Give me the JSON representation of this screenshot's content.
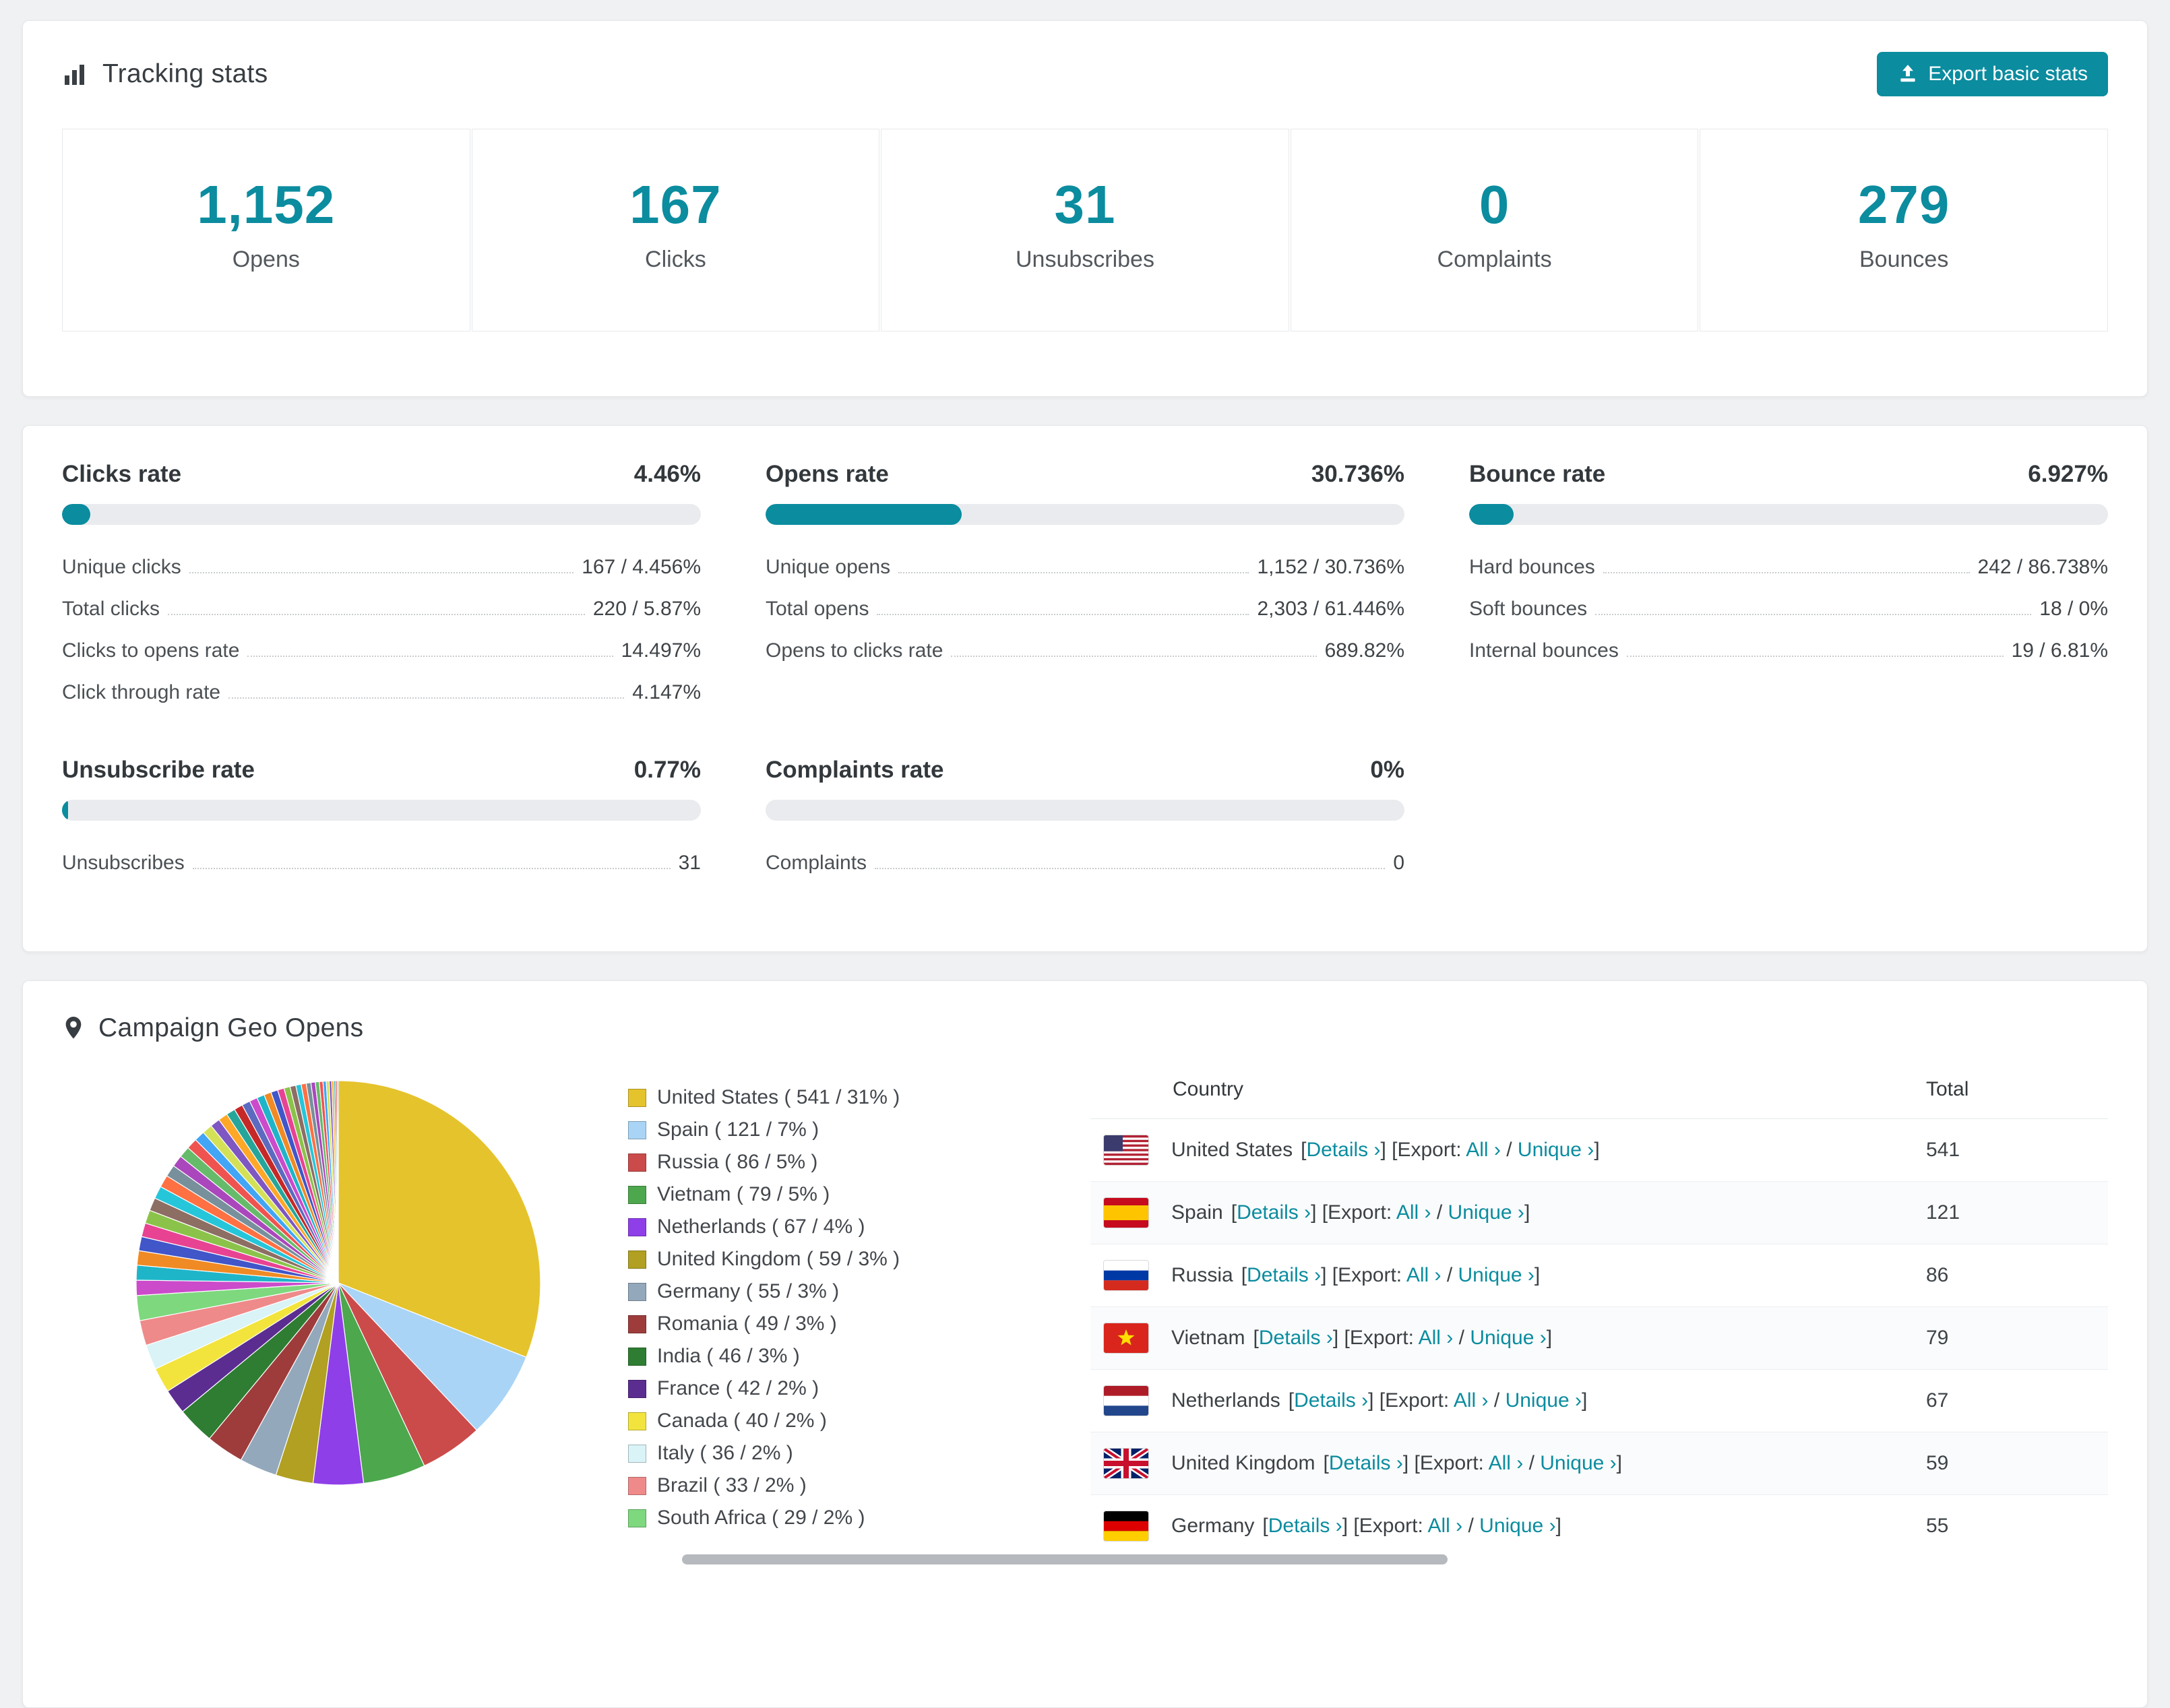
{
  "theme": {
    "accent": "#0b8c9f",
    "page_bg": "#f0f1f3",
    "card_border": "#e4e6e9",
    "bar_track": "#e9ebee"
  },
  "tracking": {
    "title": "Tracking stats",
    "export_button": "Export basic stats",
    "stats": [
      {
        "value": "1,152",
        "label": "Opens"
      },
      {
        "value": "167",
        "label": "Clicks"
      },
      {
        "value": "31",
        "label": "Unsubscribes"
      },
      {
        "value": "0",
        "label": "Complaints"
      },
      {
        "value": "279",
        "label": "Bounces"
      }
    ]
  },
  "rates": [
    {
      "title": "Clicks rate",
      "value": "4.46%",
      "percent": 4.46,
      "rows": [
        {
          "label": "Unique clicks",
          "value": "167 / 4.456%"
        },
        {
          "label": "Total clicks",
          "value": "220 / 5.87%"
        },
        {
          "label": "Clicks to opens rate",
          "value": "14.497%"
        },
        {
          "label": "Click through rate",
          "value": "4.147%"
        }
      ]
    },
    {
      "title": "Opens rate",
      "value": "30.736%",
      "percent": 30.736,
      "rows": [
        {
          "label": "Unique opens",
          "value": "1,152 / 30.736%"
        },
        {
          "label": "Total opens",
          "value": "2,303 / 61.446%"
        },
        {
          "label": "Opens to clicks rate",
          "value": "689.82%"
        }
      ]
    },
    {
      "title": "Bounce rate",
      "value": "6.927%",
      "percent": 6.927,
      "rows": [
        {
          "label": "Hard bounces",
          "value": "242 / 86.738%"
        },
        {
          "label": "Soft bounces",
          "value": "18 / 0%"
        },
        {
          "label": "Internal bounces",
          "value": "19 / 6.81%"
        }
      ]
    },
    {
      "title": "Unsubscribe rate",
      "value": "0.77%",
      "percent": 0.77,
      "rows": [
        {
          "label": "Unsubscribes",
          "value": "31"
        }
      ]
    },
    {
      "title": "Complaints rate",
      "value": "0%",
      "percent": 0,
      "rows": [
        {
          "label": "Complaints",
          "value": "0"
        }
      ]
    }
  ],
  "geo": {
    "title": "Campaign Geo Opens",
    "table": {
      "headers": [
        "Country",
        "Total"
      ],
      "labels": {
        "details": "Details",
        "export": "Export:",
        "all": "All",
        "unique": "Unique"
      },
      "rows": [
        {
          "country": "United States",
          "flag": "us",
          "total": "541"
        },
        {
          "country": "Spain",
          "flag": "es",
          "total": "121"
        },
        {
          "country": "Russia",
          "flag": "ru",
          "total": "86"
        },
        {
          "country": "Vietnam",
          "flag": "vn",
          "total": "79"
        },
        {
          "country": "Netherlands",
          "flag": "nl",
          "total": "67"
        },
        {
          "country": "United Kingdom",
          "flag": "gb",
          "total": "59"
        },
        {
          "country": "Germany",
          "flag": "de",
          "total": "55"
        }
      ]
    }
  },
  "chart_data": {
    "type": "pie",
    "title": "Campaign Geo Opens",
    "legend_position": "right",
    "slices": [
      {
        "label": "United States",
        "value": 541,
        "pct": 31,
        "color": "#e5c32c"
      },
      {
        "label": "Spain",
        "value": 121,
        "pct": 7,
        "color": "#a9d4f5"
      },
      {
        "label": "Russia",
        "value": 86,
        "pct": 5,
        "color": "#cb4b4b"
      },
      {
        "label": "Vietnam",
        "value": 79,
        "pct": 5,
        "color": "#4da74d"
      },
      {
        "label": "Netherlands",
        "value": 67,
        "pct": 4,
        "color": "#8f3fe8"
      },
      {
        "label": "United Kingdom",
        "value": 59,
        "pct": 3,
        "color": "#b1a021"
      },
      {
        "label": "Germany",
        "value": 55,
        "pct": 3,
        "color": "#93a8bb"
      },
      {
        "label": "Romania",
        "value": 49,
        "pct": 3,
        "color": "#9e3c3c"
      },
      {
        "label": "India",
        "value": 46,
        "pct": 3,
        "color": "#2e7d32"
      },
      {
        "label": "France",
        "value": 42,
        "pct": 2,
        "color": "#5b2d91"
      },
      {
        "label": "Canada",
        "value": 40,
        "pct": 2,
        "color": "#f2e43c"
      },
      {
        "label": "Italy",
        "value": 36,
        "pct": 2,
        "color": "#d9f3f7"
      },
      {
        "label": "Brazil",
        "value": 33,
        "pct": 2,
        "color": "#ef8a8a"
      },
      {
        "label": "South Africa",
        "value": 29,
        "pct": 2,
        "color": "#7ed87e"
      }
    ],
    "other_slices": {
      "approx_count": 40,
      "total_pct": 26,
      "palette": [
        "#cb4bcb",
        "#1fb5c9",
        "#f08a24",
        "#4156c8",
        "#e84393",
        "#8bc34a",
        "#8d6e63",
        "#26c6da",
        "#ff7043",
        "#78909c",
        "#ab47bc",
        "#66bb6a",
        "#ef5350",
        "#42a5f5",
        "#d4e157",
        "#7e57c2",
        "#ffa726",
        "#26a69a",
        "#c62828",
        "#5c6bc0"
      ]
    }
  }
}
